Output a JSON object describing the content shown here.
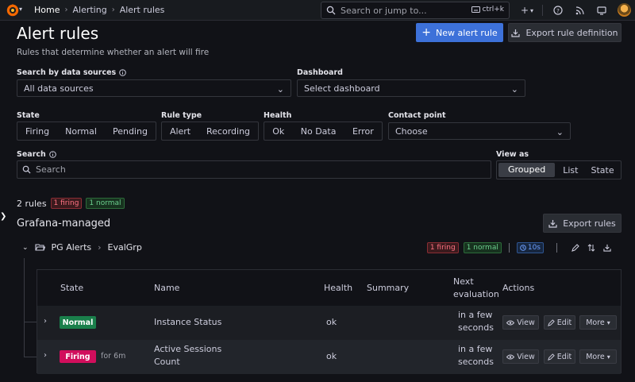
{
  "topbar": {
    "breadcrumbs": [
      "Home",
      "Alerting",
      "Alert rules"
    ],
    "search_placeholder": "Search or jump to...",
    "search_shortcut": "ctrl+k"
  },
  "header": {
    "title": "Alert rules",
    "subtitle": "Rules that determine whether an alert will fire",
    "new_rule_label": "New alert rule",
    "export_def_label": "Export rule definition"
  },
  "filters": {
    "datasource_label": "Search by data sources",
    "datasource_value": "All data sources",
    "dashboard_label": "Dashboard",
    "dashboard_value": "Select dashboard",
    "state_label": "State",
    "state_options": [
      "Firing",
      "Normal",
      "Pending"
    ],
    "ruletype_label": "Rule type",
    "ruletype_options": [
      "Alert",
      "Recording"
    ],
    "health_label": "Health",
    "health_options": [
      "Ok",
      "No Data",
      "Error"
    ],
    "contact_label": "Contact point",
    "contact_value": "Choose",
    "search_label": "Search",
    "search_placeholder": "Search",
    "viewas_label": "View as",
    "viewas_options": [
      "Grouped",
      "List",
      "State"
    ],
    "viewas_selected": "Grouped"
  },
  "summary": {
    "rules_count": "2 rules",
    "firing": "1 firing",
    "normal": "1 normal"
  },
  "section": {
    "title": "Grafana-managed",
    "export_label": "Export rules"
  },
  "group": {
    "folder": "PG Alerts",
    "name": "EvalGrp",
    "firing": "1 firing",
    "normal": "1 normal",
    "interval": "10s"
  },
  "table": {
    "headers": {
      "state": "State",
      "name": "Name",
      "health": "Health",
      "summary": "Summary",
      "next_eval_1": "Next",
      "next_eval_2": "evaluation",
      "actions": "Actions"
    },
    "rows": [
      {
        "state": "Normal",
        "state_color": "#1a7f4b",
        "since": "",
        "name_1": "Instance Status",
        "name_2": "",
        "health": "ok",
        "next_1": "in a few",
        "next_2": "seconds",
        "view": "View",
        "edit": "Edit",
        "more": "More"
      },
      {
        "state": "Firing",
        "state_color": "#d10e5c",
        "since": "for 6m",
        "name_1": "Active Sessions",
        "name_2": "Count",
        "health": "ok",
        "next_1": "in a few",
        "next_2": "seconds",
        "view": "View",
        "edit": "Edit",
        "more": "More"
      }
    ]
  }
}
